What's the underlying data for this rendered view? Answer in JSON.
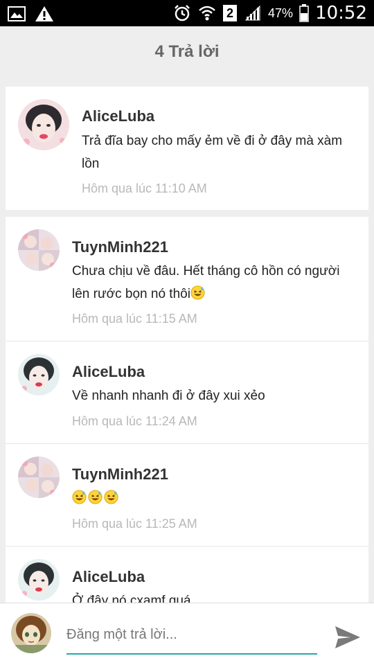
{
  "status_bar": {
    "battery": "47%",
    "time": "10:52",
    "sim_slot": "2",
    "icons": [
      "image-icon",
      "warning-icon",
      "alarm-icon",
      "wifi-icon",
      "sim-2-icon",
      "signal-icon",
      "battery-icon"
    ]
  },
  "header": {
    "title": "4 Trả lời"
  },
  "main_comment": {
    "author": "AliceLuba",
    "text": "Trả đĩa bay cho mấy ẻm về đi ở đây mà xàm lồn",
    "time": "Hôm qua lúc 11:10 AM"
  },
  "replies": [
    {
      "author": "TuynMinh221",
      "text": "Chưa chịu về đâu. Hết tháng cô hồn có người lên rước bọn nó thôi",
      "emoji": "grinning-sweat",
      "time": "Hôm qua lúc 11:15 AM"
    },
    {
      "author": "AliceLuba",
      "text": "Về nhanh nhanh đi ở đây xui xẻo",
      "time": "Hôm qua lúc 11:24 AM"
    },
    {
      "author": "TuynMinh221",
      "emojis": [
        "grinning-sweat",
        "grinning-sweat",
        "grinning-sweat"
      ],
      "time": "Hôm qua lúc 11:25 AM"
    },
    {
      "author": "AliceLuba",
      "text": "Ở đây nó cxamf quá"
    }
  ],
  "reply_bar": {
    "placeholder": "Đăng một trả lời...",
    "send_icon": "send-icon"
  },
  "colors": {
    "accent": "#26a9a5",
    "background": "#eeeeee",
    "timestamp": "#b8b8b8"
  }
}
